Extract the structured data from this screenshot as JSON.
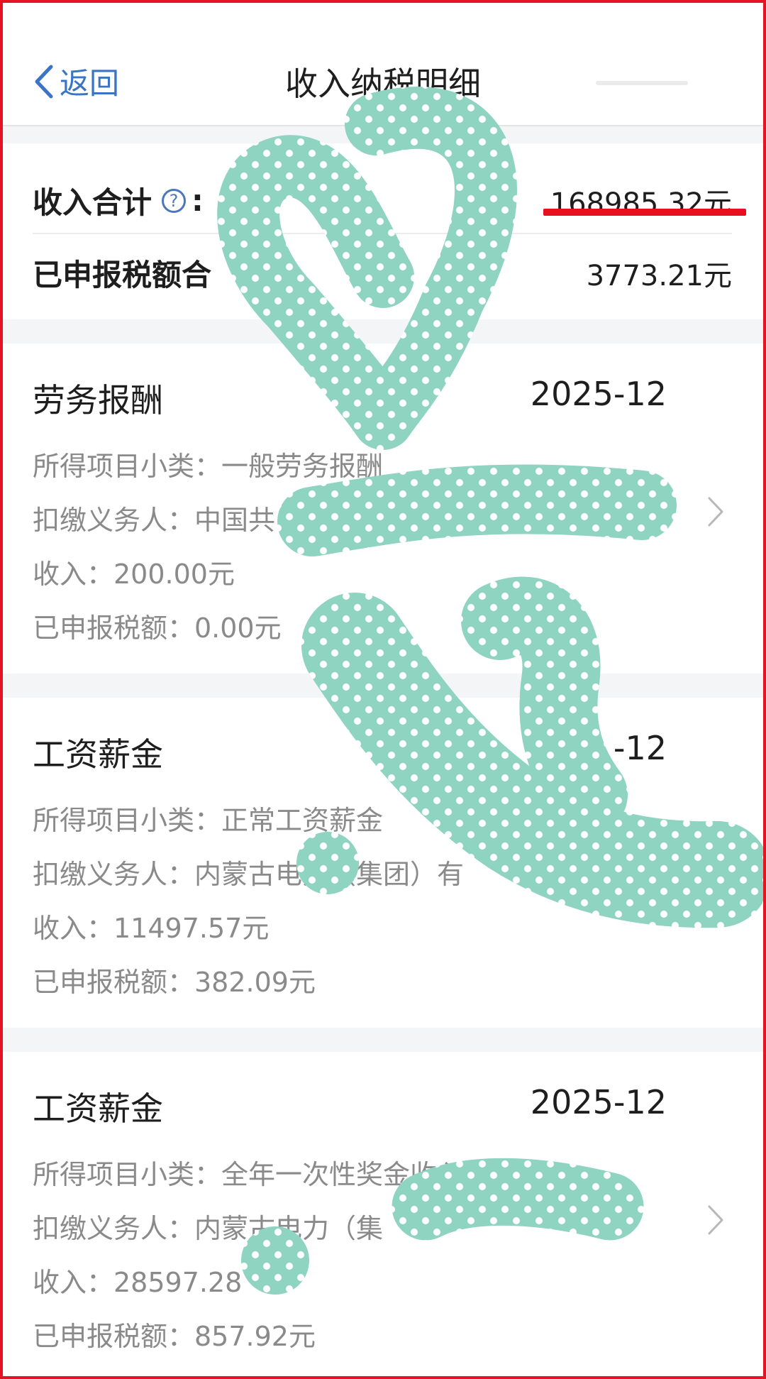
{
  "nav": {
    "back_label": "返回",
    "title": "收入纳税明细"
  },
  "summary": {
    "income_label": "收入合计",
    "income_colon": ":",
    "income_value": "168985.32元",
    "tax_label": "已申报税额合",
    "tax_value": "3773.21元"
  },
  "records": [
    {
      "type": "劳务报酬",
      "date": "2025-12",
      "subcategory": "所得项目小类：一般劳务报酬",
      "withholder": "扣缴义务人：中国共",
      "income": "收入：200.00元",
      "tax": "已申报税额：0.00元"
    },
    {
      "type": "工资薪金",
      "date": "2",
      "date_tail": "-12",
      "subcategory": "所得项目小类：正常工资薪金",
      "withholder": "扣缴义务人：内蒙古电力（集团）有",
      "income": "收入：11497.57元",
      "tax": "已申报税额：382.09元"
    },
    {
      "type": "工资薪金",
      "date": "2025-12",
      "subcategory": "所得项目小类：全年一次性奖金收入",
      "withholder": "扣缴义务人：内蒙古电力（集",
      "income": "收入：28597.28",
      "tax": "已申报税额：857.92元"
    }
  ],
  "colors": {
    "accent": "#3a74c4",
    "mark_red": "#e8101f",
    "redaction": "#8fd3c1",
    "border": "#e51425"
  },
  "icons": {
    "back": "chevron-left-icon",
    "help": "question-circle-icon",
    "row_nav": "chevron-right-icon"
  }
}
